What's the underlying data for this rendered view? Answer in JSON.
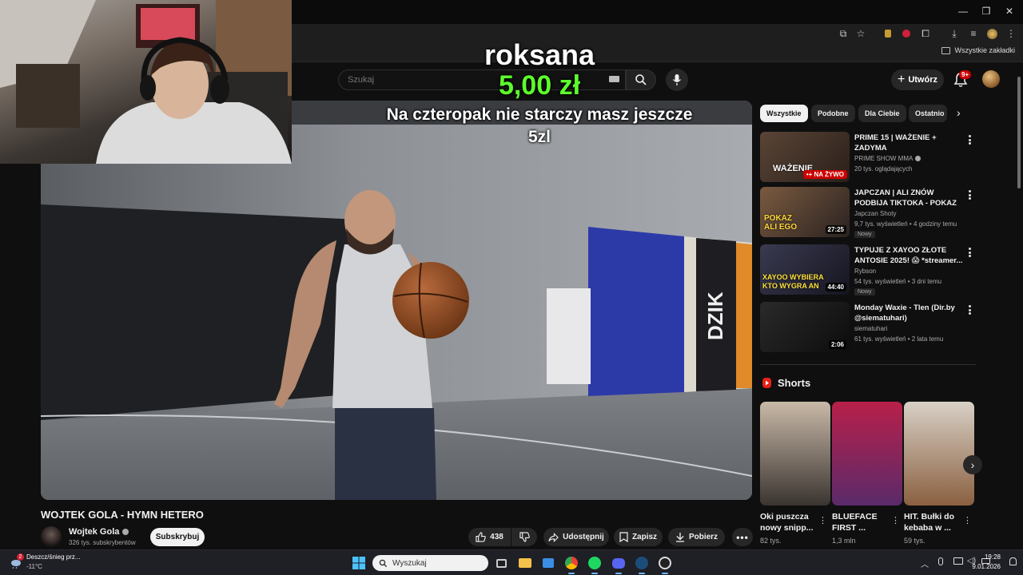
{
  "window": {
    "minimize": "—",
    "maximize": "❐",
    "close": "✕"
  },
  "bookmarks": {
    "folder_label": "Wszystkie zakładki"
  },
  "masthead": {
    "search_placeholder": "Szukaj",
    "create_label": "Utwórz",
    "notifications_badge": "9+"
  },
  "alert": {
    "name": "roksana",
    "amount": "5,00 zł",
    "message": "Na czteropak nie starczy masz jeszcze 5zl"
  },
  "video": {
    "title": "WOJTEK GOLA - HYMN HETERO",
    "channel_name": "Wojtek Gola",
    "subscribers": "326 tys. subskrybentów",
    "subscribe_label": "Subskrybuj",
    "likes": "438",
    "share_label": "Udostępnij",
    "save_label": "Zapisz",
    "download_label": "Pobierz",
    "player_sign": "DZIK"
  },
  "chips": [
    "Wszystkie",
    "Podobne",
    "Dla Ciebie",
    "Ostatnio"
  ],
  "recommendations": [
    {
      "title": "PRIME 15 | WAŻENIE + ZADYMA",
      "channel": "PRIME SHOW MMA",
      "verified": true,
      "meta": "20 tys. oglądających",
      "live": "NA ŻYWO",
      "thumb_text": "WAŻENIE",
      "thumb_color": "#3a2a24"
    },
    {
      "title": "JAPCZAN | ALI ZNÓW PODBIJA TIKTOKA - POKAZ ROWERÓW |",
      "channel": "Japczan Shoty",
      "verified": false,
      "meta": "9,7 tys. wyświetleń • 4 godziny temu",
      "badge": "Nowy",
      "duration": "27:25",
      "thumb_text": "POKAZ ALI EGO",
      "thumb_color": "#5a4a3a"
    },
    {
      "title": "TYPUJE Z XAYOO ZŁOTE ANTOSIE 2025! 😱 *streamer...",
      "channel": "Rybson",
      "verified": false,
      "meta": "54 tys. wyświetleń • 3 dni temu",
      "badge": "Nowy",
      "duration": "44:40",
      "thumb_text": "XAYOO WYBIERA KTO WYGRA AN",
      "thumb_color": "#2a2a3a"
    },
    {
      "title": "Monday Waxie - Tlen (Dir.by @siematuhari)",
      "channel": "siematuhari",
      "verified": false,
      "meta": "61 tys. wyświetleń • 2 lata temu",
      "duration": "2:06",
      "thumb_text": "",
      "thumb_color": "#1c1c1c"
    }
  ],
  "shorts": {
    "heading": "Shorts",
    "items": [
      {
        "title": "Oki puszcza nowy snipp...",
        "views": "82 tys.",
        "color1": "#c9b9a8",
        "color2": "#3a3430"
      },
      {
        "title": "BLUEFACE FIRST ...",
        "views": "1,3 mln",
        "color1": "#b8204a",
        "color2": "#5a2a6a"
      },
      {
        "title": "HIT. Bułki do kebaba w ...",
        "views": "59 tys.",
        "color1": "#d8d0c6",
        "color2": "#8a6040"
      }
    ]
  },
  "taskbar": {
    "weather_text": "Deszcz/śnieg prz...",
    "weather_temp": "-11°C",
    "weather_badge": "2",
    "search_placeholder": "Wyszukaj",
    "time": "19:28",
    "date": "9.01.2026"
  }
}
